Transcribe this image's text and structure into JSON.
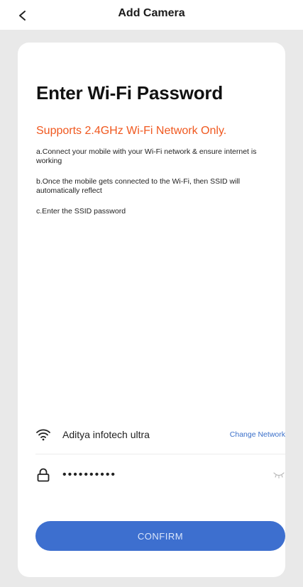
{
  "header": {
    "title": "Add Camera",
    "back_icon": "chevron-left-icon"
  },
  "content": {
    "title": "Enter Wi-Fi Password",
    "subtitle": "Supports 2.4GHz Wi-Fi Network Only.",
    "steps": [
      "a.Connect your mobile with your Wi-Fi network & ensure internet is working",
      "b.Once the mobile gets connected to the Wi-Fi, then SSID will automatically reflect",
      "c.Enter the SSID password"
    ]
  },
  "network": {
    "icon": "wifi-icon",
    "name": "Aditya infotech ultra",
    "change_label": "Change Network"
  },
  "password": {
    "icon": "lock-icon",
    "value": "••••••••••",
    "toggle_icon": "eye-hidden-icon"
  },
  "confirm": {
    "label": "CONFIRM"
  },
  "colors": {
    "accent": "#3d6fcf",
    "warning": "#f0581f",
    "link": "#3a6fc9",
    "background": "#e9e9e9"
  }
}
